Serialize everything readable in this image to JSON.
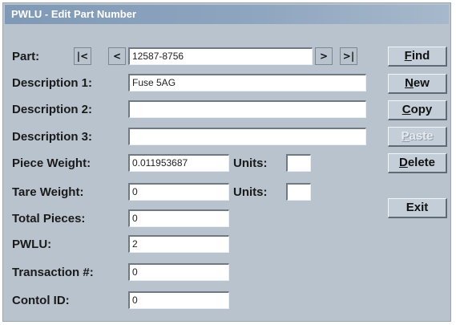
{
  "window": {
    "title": "PWLU - Edit Part Number"
  },
  "part": {
    "label": "Part:",
    "value": "12587-8756",
    "nav_first": "|<",
    "nav_prev": "<",
    "nav_next": ">",
    "nav_last": ">|"
  },
  "fields": {
    "description1": {
      "label": "Description 1:",
      "value": "Fuse 5AG"
    },
    "description2": {
      "label": "Description 2:",
      "value": ""
    },
    "description3": {
      "label": "Description 3:",
      "value": ""
    },
    "piece_weight": {
      "label": "Piece Weight:",
      "value": "0.011953687",
      "units_label": "Units:",
      "units_value": ""
    },
    "tare_weight": {
      "label": "Tare Weight:",
      "value": "0",
      "units_label": "Units:",
      "units_value": ""
    },
    "total_pieces": {
      "label": "Total Pieces:",
      "value": "0"
    },
    "pwlu": {
      "label": "PWLU:",
      "value": "2"
    },
    "transaction": {
      "label": "Transaction #:",
      "value": "0"
    },
    "control_id": {
      "label": "Contol ID:",
      "value": "0"
    }
  },
  "buttons": {
    "find": {
      "accel": "F",
      "rest": "ind"
    },
    "new": {
      "accel": "N",
      "rest": "ew"
    },
    "copy": {
      "accel": "C",
      "rest": "opy"
    },
    "paste": {
      "accel": "P",
      "rest": "aste",
      "state": "disabled"
    },
    "delete": {
      "accel": "D",
      "rest": "elete"
    },
    "exit": {
      "label": "Exit"
    }
  },
  "colors": {
    "window_bg": "#b8c3cd",
    "titlebar": "#8ea5bf",
    "field_bg": "#ffffff"
  }
}
